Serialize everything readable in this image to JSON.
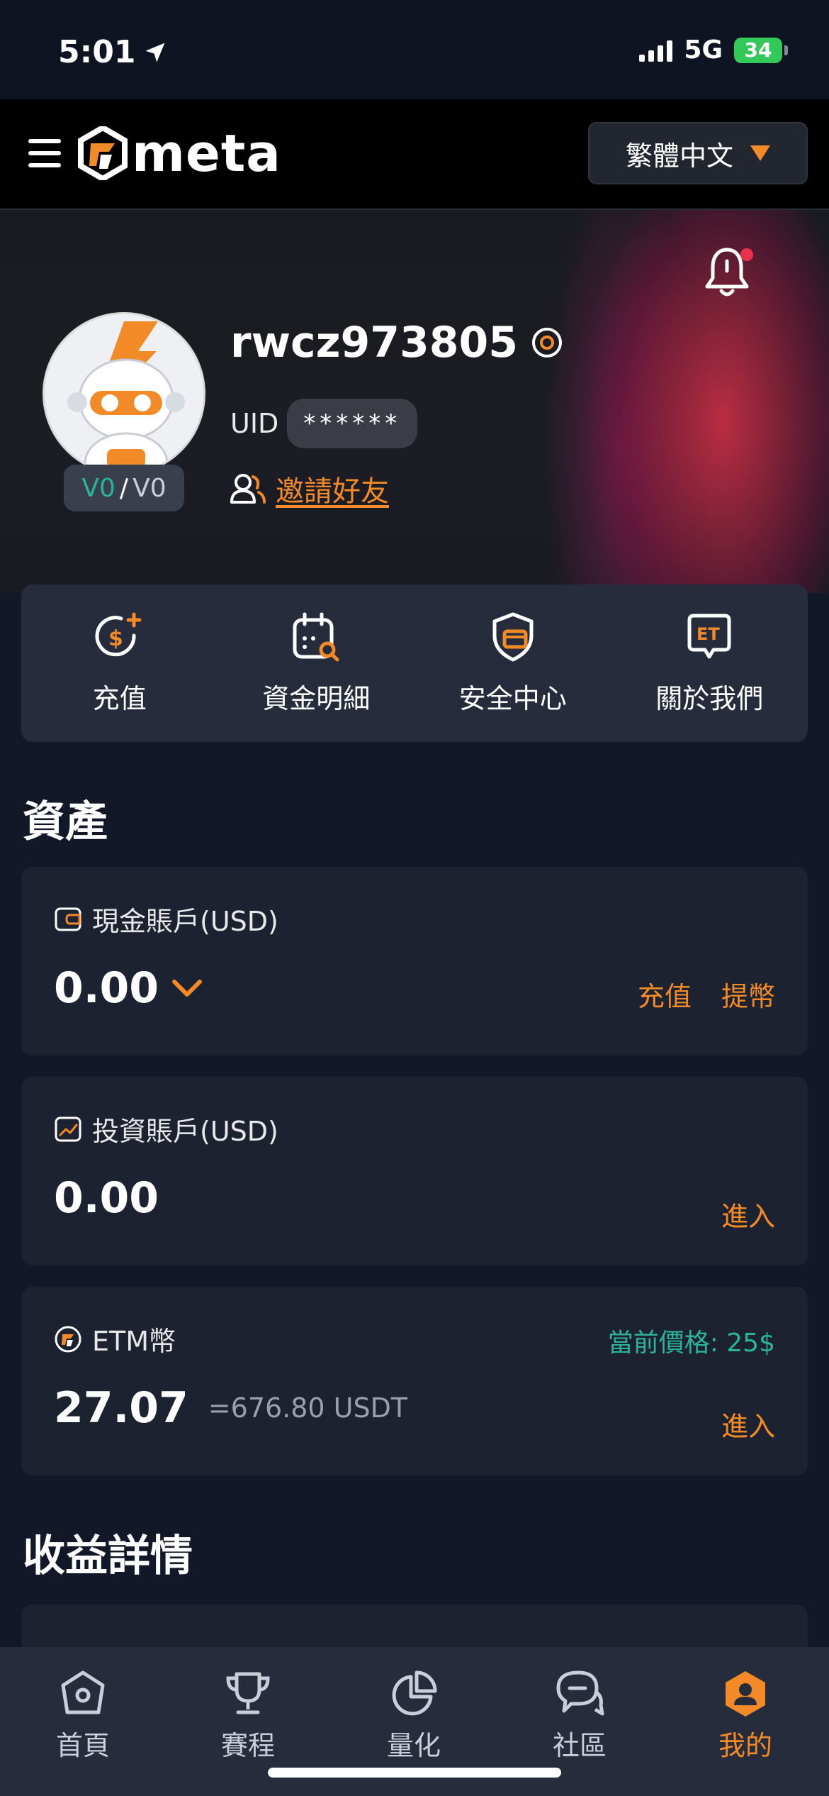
{
  "status_bar": {
    "time": "5:01",
    "network": "5G",
    "battery": "34"
  },
  "header": {
    "logo_text": "meta",
    "language": "繁體中文"
  },
  "profile": {
    "username": "rwcz973805",
    "uid_label": "UID",
    "uid_value": "******",
    "level_current": "V0",
    "level_separator": "/",
    "level_max": "V0",
    "invite_label": "邀請好友"
  },
  "quick_actions": [
    {
      "label": "充值",
      "icon": "deposit-icon"
    },
    {
      "label": "資金明細",
      "icon": "fund-details-icon"
    },
    {
      "label": "安全中心",
      "icon": "security-icon"
    },
    {
      "label": "關於我們",
      "icon": "about-us-icon"
    }
  ],
  "assets": {
    "title": "資產",
    "cash": {
      "label": "現金賬戶(USD)",
      "amount": "0.00",
      "deposit": "充值",
      "withdraw": "提幣"
    },
    "investment": {
      "label": "投資賬戶(USD)",
      "amount": "0.00",
      "enter": "進入"
    },
    "etm": {
      "label": "ETM幣",
      "price": "當前價格: 25$",
      "amount": "27.07",
      "equivalent": "=676.80 USDT",
      "enter": "進入"
    }
  },
  "earnings": {
    "title": "收益詳情"
  },
  "tabbar": [
    {
      "label": "首頁",
      "icon": "home-icon"
    },
    {
      "label": "賽程",
      "icon": "trophy-icon"
    },
    {
      "label": "量化",
      "icon": "pie-chart-icon"
    },
    {
      "label": "社區",
      "icon": "chat-icon"
    },
    {
      "label": "我的",
      "icon": "profile-icon"
    }
  ],
  "colors": {
    "accent": "#f28a28",
    "green": "#2bb39a",
    "background": "#121827",
    "card": "#1d2230",
    "notification_dot": "#e8334a"
  }
}
